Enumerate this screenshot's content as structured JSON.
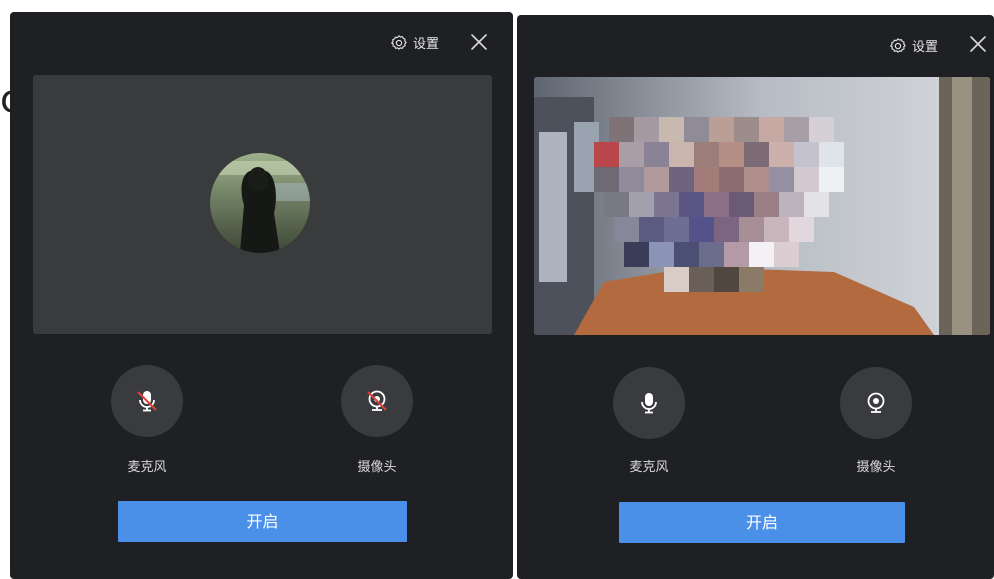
{
  "background_fragment": "ⅽ",
  "panels": [
    {
      "state": "camera-off",
      "settings_label": "设置",
      "microphone": {
        "label": "麦克风",
        "state": "muted"
      },
      "camera": {
        "label": "摄像头",
        "state": "off"
      },
      "start_button_label": "开启"
    },
    {
      "state": "camera-on",
      "settings_label": "设置",
      "microphone": {
        "label": "麦克风",
        "state": "on"
      },
      "camera": {
        "label": "摄像头",
        "state": "on"
      },
      "start_button_label": "开启"
    }
  ],
  "colors": {
    "panel_bg": "#1f2023",
    "preview_bg": "#3a3b3d",
    "control_bg": "#3a3b3e",
    "primary": "#4a90e8",
    "disabled_slash": "#e0413a"
  },
  "icons": [
    "gear-icon",
    "close-icon",
    "microphone-icon",
    "camera-icon"
  ]
}
